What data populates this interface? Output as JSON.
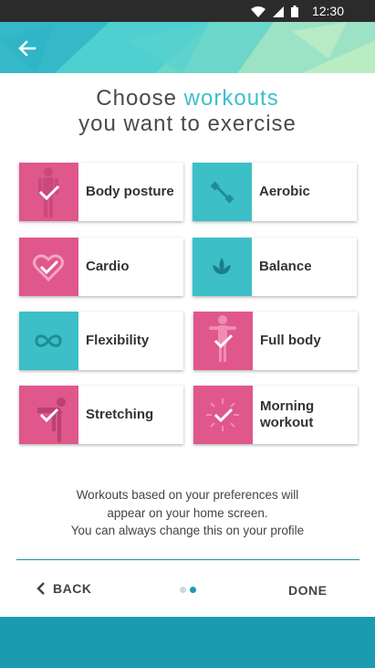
{
  "status_bar": {
    "time": "12:30",
    "icons": [
      "wifi-icon",
      "signal-icon",
      "battery-icon"
    ]
  },
  "header": {
    "back_icon": "back-arrow-icon"
  },
  "title": {
    "line1_prefix": "Choose ",
    "line1_accent": "workouts",
    "line2": "you want to exercise"
  },
  "workouts": [
    {
      "label": "Body posture",
      "color": "pink",
      "selected": true,
      "icon": "body-posture-icon"
    },
    {
      "label": "Aerobic",
      "color": "teal",
      "selected": false,
      "icon": "aerobic-icon"
    },
    {
      "label": "Cardio",
      "color": "pink",
      "selected": true,
      "icon": "heart-icon"
    },
    {
      "label": "Balance",
      "color": "teal",
      "selected": false,
      "icon": "lotus-icon"
    },
    {
      "label": "Flexibility",
      "color": "teal",
      "selected": false,
      "icon": "infinity-icon"
    },
    {
      "label": "Full body",
      "color": "pink",
      "selected": true,
      "icon": "full-body-icon"
    },
    {
      "label": "Stretching",
      "color": "pink",
      "selected": true,
      "icon": "stretching-icon"
    },
    {
      "label": "Morning workout",
      "color": "pink",
      "selected": true,
      "icon": "sun-icon"
    }
  ],
  "info": {
    "line1": "Workouts based on your preferences will",
    "line2": "appear on your home screen.",
    "line3": "You can always change this on your profile"
  },
  "footer": {
    "back_label": "BACK",
    "done_label": "DONE",
    "page_count": 2,
    "current_page": 2
  },
  "colors": {
    "accent": "#3cc0cc",
    "pink": "#e0578b",
    "teal": "#3cbfc7",
    "bar": "#1b9bb0"
  }
}
